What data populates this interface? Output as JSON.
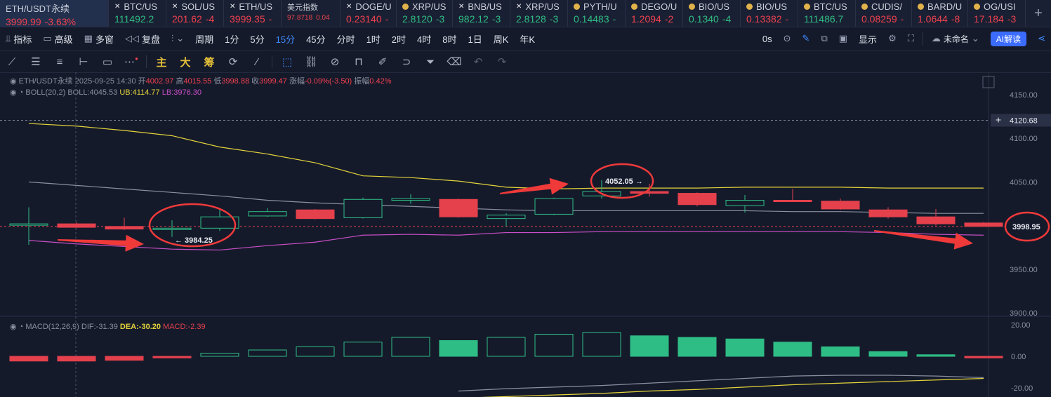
{
  "tickers": [
    {
      "name": "ETH/USDT永续",
      "price": "3999.99",
      "change": "-3.63%",
      "dir": "dn",
      "icon": "",
      "active": true
    },
    {
      "name": "BTC/US",
      "price": "111492.2",
      "change": "",
      "dir": "up",
      "icon": "x"
    },
    {
      "name": "SOL/US",
      "price": "201.62",
      "change": "-4",
      "dir": "dn",
      "icon": "x"
    },
    {
      "name": "ETH/US",
      "price": "3999.35",
      "change": "-",
      "dir": "dn",
      "icon": "x"
    },
    {
      "name": "美元指数",
      "price": "97.8718",
      "change": "0.04",
      "dir": "dn",
      "icon": ""
    },
    {
      "name": "DOGE/U",
      "price": "0.23140",
      "change": "-",
      "dir": "dn",
      "icon": "x"
    },
    {
      "name": "XRP/US",
      "price": "2.8120",
      "change": "-3",
      "dir": "up",
      "icon": "c"
    },
    {
      "name": "BNB/US",
      "price": "982.12",
      "change": "-3",
      "dir": "up",
      "icon": "x"
    },
    {
      "name": "XRP/US",
      "price": "2.8128",
      "change": "-3",
      "dir": "up",
      "icon": "x"
    },
    {
      "name": "PYTH/U",
      "price": "0.14483",
      "change": "-",
      "dir": "up",
      "icon": "c"
    },
    {
      "name": "DEGO/U",
      "price": "1.2094",
      "change": "-2",
      "dir": "dn",
      "icon": "c"
    },
    {
      "name": "BIO/US",
      "price": "0.1340",
      "change": "-4",
      "dir": "up",
      "icon": "c"
    },
    {
      "name": "BIO/US",
      "price": "0.13382",
      "change": "-",
      "dir": "dn",
      "icon": "c"
    },
    {
      "name": "BTC/US",
      "price": "111486.7",
      "change": "",
      "dir": "up",
      "icon": "c"
    },
    {
      "name": "CUDIS/",
      "price": "0.08259",
      "change": "-",
      "dir": "dn",
      "icon": "c"
    },
    {
      "name": "BARD/U",
      "price": "1.0644",
      "change": "-8",
      "dir": "dn",
      "icon": "c"
    },
    {
      "name": "OG/USI",
      "price": "17.184",
      "change": "-3",
      "dir": "dn",
      "icon": "c"
    }
  ],
  "toolbar": {
    "indicator": "指标",
    "advanced": "高级",
    "multi": "多窗",
    "replay": "复盘",
    "period": "周期",
    "intervals": [
      "1分",
      "5分",
      "15分",
      "45分",
      "分时",
      "1时",
      "2时",
      "4时",
      "8时",
      "1日",
      "周K",
      "年K"
    ],
    "selected_interval": "15分",
    "timer": "0s",
    "display": "显示",
    "unnamed": "未命名",
    "ai": "AI解读"
  },
  "drawbar": [
    "主",
    "大",
    "筹"
  ],
  "info": {
    "symbol": "ETH/USDT永续",
    "time": "2025-09-25 14:30",
    "open_label": "开",
    "open": "4002.97",
    "high_label": "高",
    "high": "4015.55",
    "low_label": "低",
    "low": "3998.88",
    "close_label": "收",
    "close": "3999.47",
    "chg_label": "涨幅",
    "chg": "-0.09%(-3.50)",
    "amp_label": "振幅",
    "amp": "0.42%",
    "boll": "BOLL(20,2)",
    "boll_mid": "BOLL:4045.53",
    "boll_ub": "UB:4114.77",
    "boll_lb": "LB:3976.30",
    "macd": "MACD(12,26,9)",
    "dif": "DIF:-31.39",
    "dea": "DEA:-30.20",
    "macd_val": "MACD:-2.39"
  },
  "colors": {
    "up": "#2ebd85",
    "down": "#e5414d",
    "ub": "#e3d43a",
    "mid": "#8a90a0",
    "lb": "#c94fc6",
    "dea": "#e3d43a",
    "dif": "#8a90a0",
    "annot": "#f03a3a"
  },
  "chart_data": {
    "type": "candlestick",
    "price_axis": {
      "min": 3880,
      "max": 4170,
      "ticks": [
        3900,
        3950,
        4000,
        4050,
        4100,
        4150
      ],
      "labels": [
        "3900.00",
        "3950.00",
        "4000.00",
        "4050.00",
        "4100.00",
        "4150.00"
      ]
    },
    "crosshair_price": "4120.68",
    "last_price": "3998.95",
    "candles": [
      {
        "o": 4002,
        "c": 4002,
        "h": 4021,
        "l": 3978
      },
      {
        "o": 4002,
        "c": 3998,
        "h": 4004,
        "l": 3997
      },
      {
        "o": 3999,
        "c": 3996,
        "h": 4009,
        "l": 3995
      },
      {
        "o": 3996,
        "c": 3997,
        "h": 4006,
        "l": 3987
      },
      {
        "o": 3997,
        "c": 4010,
        "h": 4019,
        "l": 3994
      },
      {
        "o": 4011,
        "c": 4016,
        "h": 4020,
        "l": 4010
      },
      {
        "o": 4018,
        "c": 4008,
        "h": 4019,
        "l": 4007
      },
      {
        "o": 4009,
        "c": 4030,
        "h": 4032,
        "l": 4008
      },
      {
        "o": 4029,
        "c": 4031,
        "h": 4036,
        "l": 4025
      },
      {
        "o": 4030,
        "c": 4010,
        "h": 4031,
        "l": 4009
      },
      {
        "o": 4008,
        "c": 4012,
        "h": 4014,
        "l": 3999
      },
      {
        "o": 4013,
        "c": 4031,
        "h": 4032,
        "l": 4012
      },
      {
        "o": 4034,
        "c": 4039,
        "h": 4052,
        "l": 4031
      },
      {
        "o": 4039,
        "c": 4037,
        "h": 4048,
        "l": 4033
      },
      {
        "o": 4037,
        "c": 4024,
        "h": 4038,
        "l": 4022
      },
      {
        "o": 4023,
        "c": 4029,
        "h": 4035,
        "l": 4015
      },
      {
        "o": 4029,
        "c": 4028,
        "h": 4042,
        "l": 4027
      },
      {
        "o": 4028,
        "c": 4019,
        "h": 4031,
        "l": 4018
      },
      {
        "o": 4018,
        "c": 4010,
        "h": 4021,
        "l": 4008
      },
      {
        "o": 4010,
        "c": 4002,
        "h": 4019,
        "l": 4000
      },
      {
        "o": 4003,
        "c": 3999,
        "h": 4004,
        "l": 3999
      }
    ],
    "boll_ub": [
      4117,
      4114,
      4109,
      4103,
      4090,
      4082,
      4072,
      4057,
      4055,
      4051,
      4044,
      4042,
      4043,
      4043,
      4043,
      4044,
      4044,
      4044,
      4043,
      4043,
      4043
    ],
    "boll_mid": [
      4050,
      4046,
      4042,
      4038,
      4034,
      4029,
      4026,
      4024,
      4022,
      4020,
      4018,
      4017,
      4017,
      4017,
      4017,
      4017,
      4016,
      4016,
      4015,
      4014,
      4014
    ],
    "boll_lb": [
      3983,
      3979,
      3976,
      3973,
      3972,
      3977,
      3981,
      3989,
      3990,
      3989,
      3992,
      3992,
      3993,
      3993,
      3993,
      3993,
      3993,
      3993,
      3992,
      3990,
      3989
    ],
    "annotations": {
      "low": "3984.25",
      "high": "4052.05"
    },
    "macd_axis": {
      "ticks": [
        20,
        0,
        -20
      ],
      "labels": [
        "20.00",
        "0.00",
        "-20.00"
      ]
    },
    "macd_hist": [
      -3,
      -3,
      -2.5,
      -1,
      2,
      4,
      6,
      9,
      12,
      10,
      12,
      14,
      15,
      13,
      12,
      11,
      9,
      6,
      3,
      1,
      -1
    ],
    "dif": [
      null,
      null,
      null,
      null,
      null,
      null,
      null,
      null,
      null,
      -22,
      -20.5,
      -19.5,
      -18.5,
      -17,
      -15.5,
      -14,
      -12.5,
      -12,
      -12,
      -12.5,
      -13.5
    ],
    "dea": [
      null,
      null,
      null,
      null,
      null,
      null,
      null,
      null,
      null,
      -26.5,
      -25.5,
      -24.5,
      -23.5,
      -22,
      -21,
      -19.5,
      -18,
      -17,
      -16,
      -15,
      -14
    ]
  }
}
